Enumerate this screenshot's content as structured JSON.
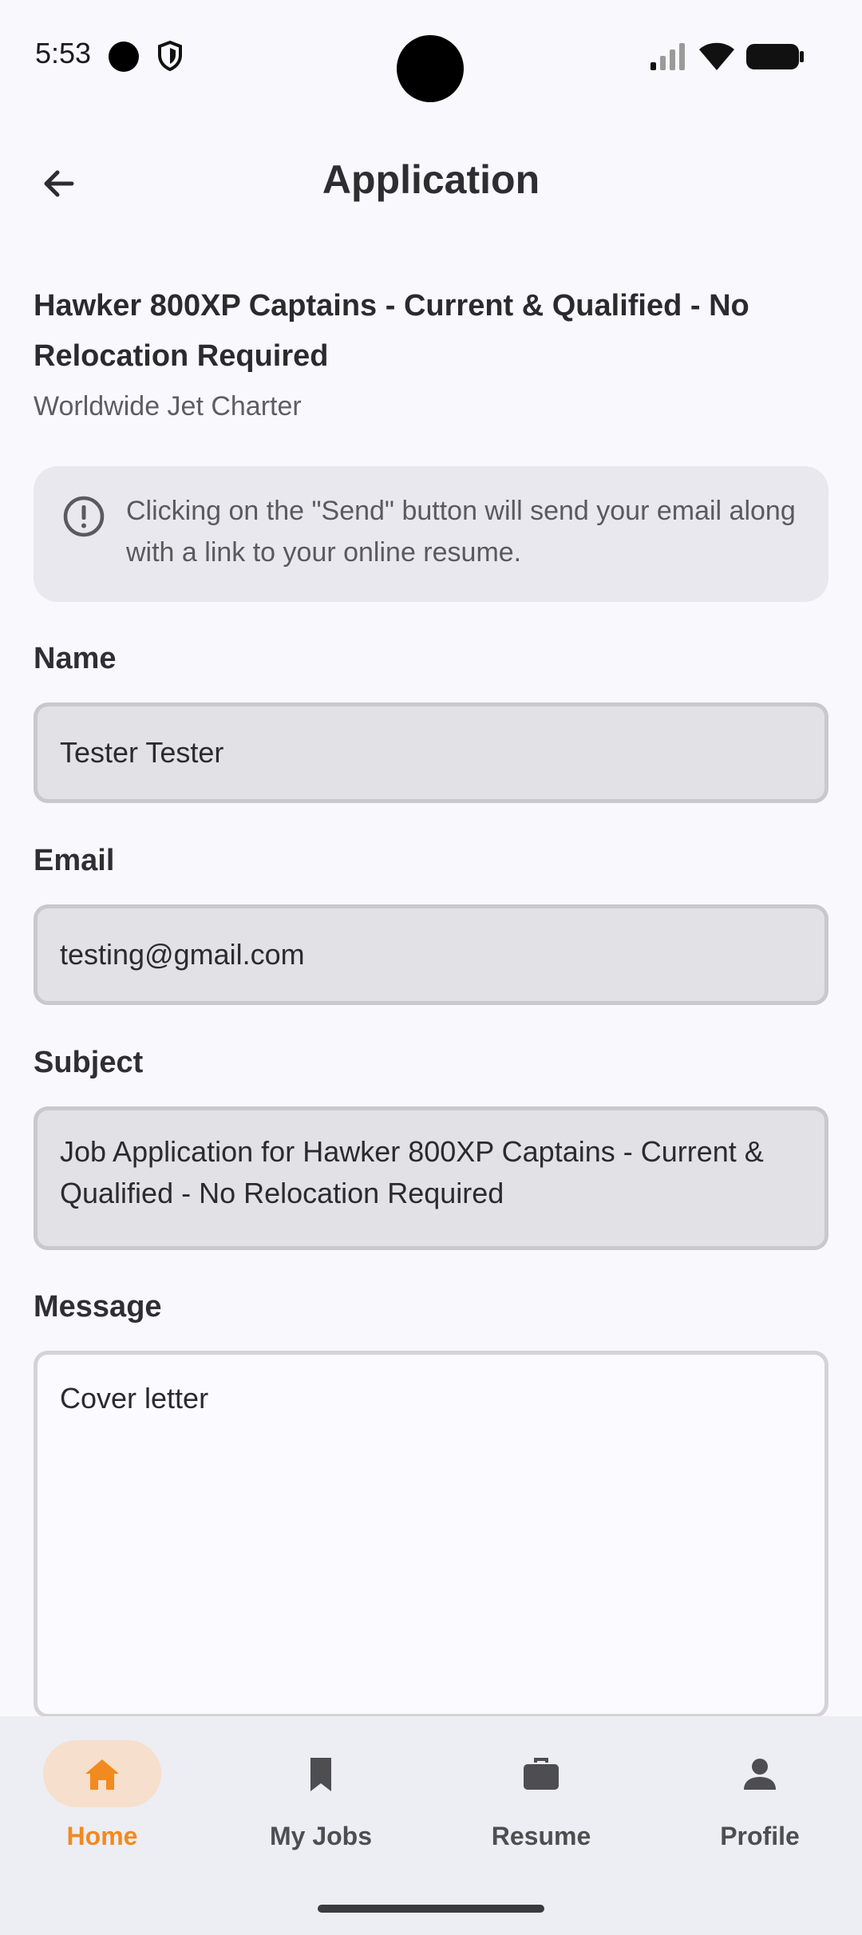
{
  "status_bar": {
    "time": "5:53"
  },
  "app_bar": {
    "title": "Application"
  },
  "job": {
    "title": "Hawker 800XP Captains - Current & Qualified - No Relocation Required",
    "company": "Worldwide Jet Charter"
  },
  "info": {
    "text": "Clicking on the \"Send\" button will send your email along with a link to your online resume."
  },
  "form": {
    "name_label": "Name",
    "name_value": "Tester Tester",
    "email_label": "Email",
    "email_value": "testing@gmail.com",
    "subject_label": "Subject",
    "subject_value": "Job Application for Hawker 800XP Captains - Current & Qualified - No Relocation Required",
    "message_label": "Message",
    "message_value": "Cover letter"
  },
  "nav": {
    "items": [
      {
        "label": "Home",
        "icon": "home-icon",
        "active": true
      },
      {
        "label": "My Jobs",
        "icon": "bookmark-icon",
        "active": false
      },
      {
        "label": "Resume",
        "icon": "briefcase-icon",
        "active": false
      },
      {
        "label": "Profile",
        "icon": "person-icon",
        "active": false
      }
    ]
  },
  "colors": {
    "accent": "#f28a1f",
    "active_pill": "#f6dfcc",
    "background": "#f9f8fd"
  }
}
